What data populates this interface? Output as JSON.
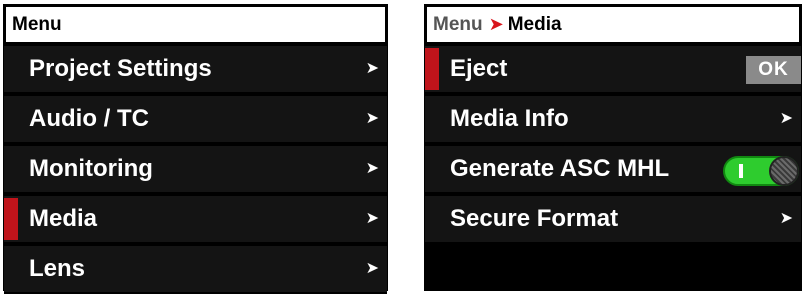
{
  "left_panel": {
    "header": "Menu",
    "items": [
      {
        "label": "Project Settings",
        "chevron": "➤"
      },
      {
        "label": "Audio / TC",
        "chevron": "➤"
      },
      {
        "label": "Monitoring",
        "chevron": "➤"
      },
      {
        "label": "Media",
        "chevron": "➤",
        "selected": true
      },
      {
        "label": "Lens",
        "chevron": "➤"
      }
    ]
  },
  "right_panel": {
    "breadcrumb": {
      "parent": "Menu",
      "separator": "➤",
      "current": "Media"
    },
    "items": [
      {
        "label": "Eject",
        "control": "button",
        "button_label": "OK",
        "selected": true
      },
      {
        "label": "Media Info",
        "control": "chevron",
        "chevron": "➤"
      },
      {
        "label": "Generate ASC MHL",
        "control": "toggle",
        "toggle_on": true
      },
      {
        "label": "Secure Format",
        "control": "chevron",
        "chevron": "➤"
      }
    ]
  },
  "colors": {
    "selection_accent": "#c0141b",
    "toggle_on": "#2ecc2e",
    "row_background": "#141414",
    "button_background": "#8a8a8a"
  }
}
